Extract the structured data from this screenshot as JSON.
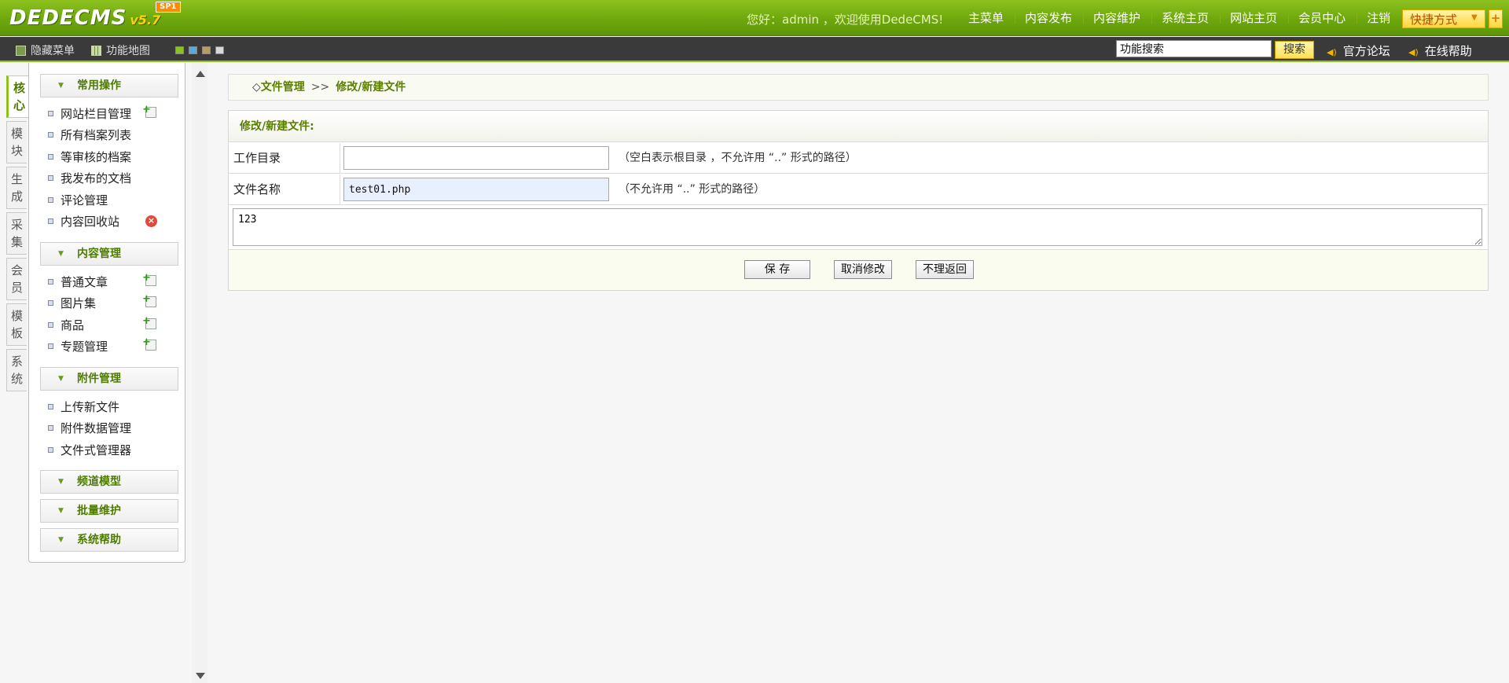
{
  "header": {
    "brand": "DEDECMS",
    "version": "v5.7",
    "edition": "SP1",
    "welcome": "您好：admin ，欢迎使用DedeCMS!",
    "nav": [
      "主菜单",
      "内容发布",
      "内容维护",
      "系统主页",
      "网站主页",
      "会员中心",
      "注销"
    ],
    "quick_label": "快捷方式",
    "quick_plus": "+"
  },
  "subbar": {
    "hide_menu": "隐藏菜单",
    "site_map": "功能地图",
    "search_value": "功能搜索",
    "search_button": "搜索",
    "forum": "官方论坛",
    "help": "在线帮助",
    "swatch_colors": [
      "#8dc21f",
      "#5aa9dd",
      "#b59a6a",
      "#d8d8d8"
    ]
  },
  "vtabs": [
    "核心",
    "模块",
    "生成",
    "采集",
    "会员",
    "模板",
    "系统"
  ],
  "menu": {
    "sections": [
      {
        "title": "常用操作",
        "items": [
          "网站栏目管理",
          "所有档案列表",
          "等审核的档案",
          "我发布的文档",
          "评论管理",
          "内容回收站"
        ]
      },
      {
        "title": "内容管理",
        "items": [
          "普通文章",
          "图片集",
          "商品",
          "专题管理"
        ]
      },
      {
        "title": "附件管理",
        "items": [
          "上传新文件",
          "附件数据管理",
          "文件式管理器"
        ]
      },
      {
        "title": "频道模型"
      },
      {
        "title": "批量维护"
      },
      {
        "title": "系统帮助"
      }
    ]
  },
  "breadcrumb": {
    "prefix": "◇",
    "root": "文件管理",
    "sep": ">>",
    "current": "修改/新建文件"
  },
  "form": {
    "title": "修改/新建文件:",
    "workdir_label": "工作目录",
    "workdir_value": "",
    "workdir_hint": "（空白表示根目录 ，不允许用 “..” 形式的路径）",
    "filename_label": "文件名称",
    "filename_value": "test01.php",
    "filename_hint": "（不允许用 “..” 形式的路径）",
    "content": "123",
    "save": "保 存",
    "cancel": "取消修改",
    "back": "不理返回"
  },
  "colors": {
    "accent": "#8dc21f",
    "link": "#5a7d00",
    "topbar": "#6ea70c"
  }
}
